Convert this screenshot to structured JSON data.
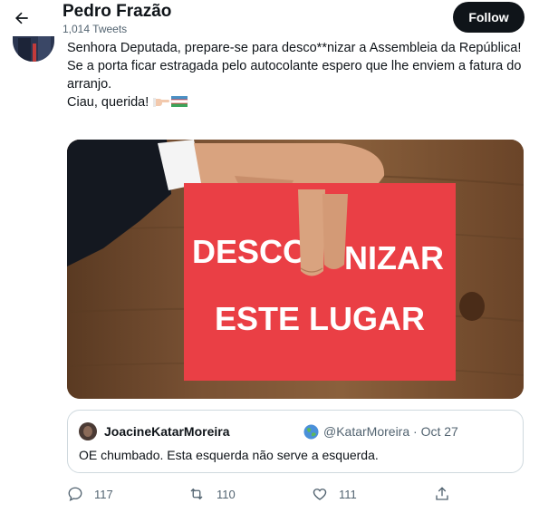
{
  "header": {
    "name": "Pedro Frazão",
    "tweet_count": "1,014 Tweets",
    "follow_label": "Follow",
    "back_icon": "arrow-left-icon"
  },
  "tweet": {
    "lines": [
      "Senhora Deputada, prepare-se para desco**nizar a Assembleia da República!",
      "Se a porta ficar estragada pelo autocolante espero que lhe enviem a fatura do arranjo.",
      "Ciau, querida!"
    ],
    "emojis": [
      "pointing-hand-icon",
      "flag-icon"
    ]
  },
  "media": {
    "sign_line1_left": "DESCO",
    "sign_line1_right": "NIZAR",
    "sign_line2": "ESTE LUGAR",
    "sign_color": "#ea3f45"
  },
  "quote": {
    "name": "JoacineKatarMoreira",
    "handle": "@KatarMoreira · Oct 27",
    "text": "OE chumbado. Esta esquerda não serve a esquerda."
  },
  "actions": {
    "replies": "117",
    "retweets": "110",
    "likes": "111"
  },
  "colors": {
    "text": "#0f1419",
    "secondary": "#536471",
    "border": "#cfd9de",
    "follow_bg": "#0f1419"
  }
}
